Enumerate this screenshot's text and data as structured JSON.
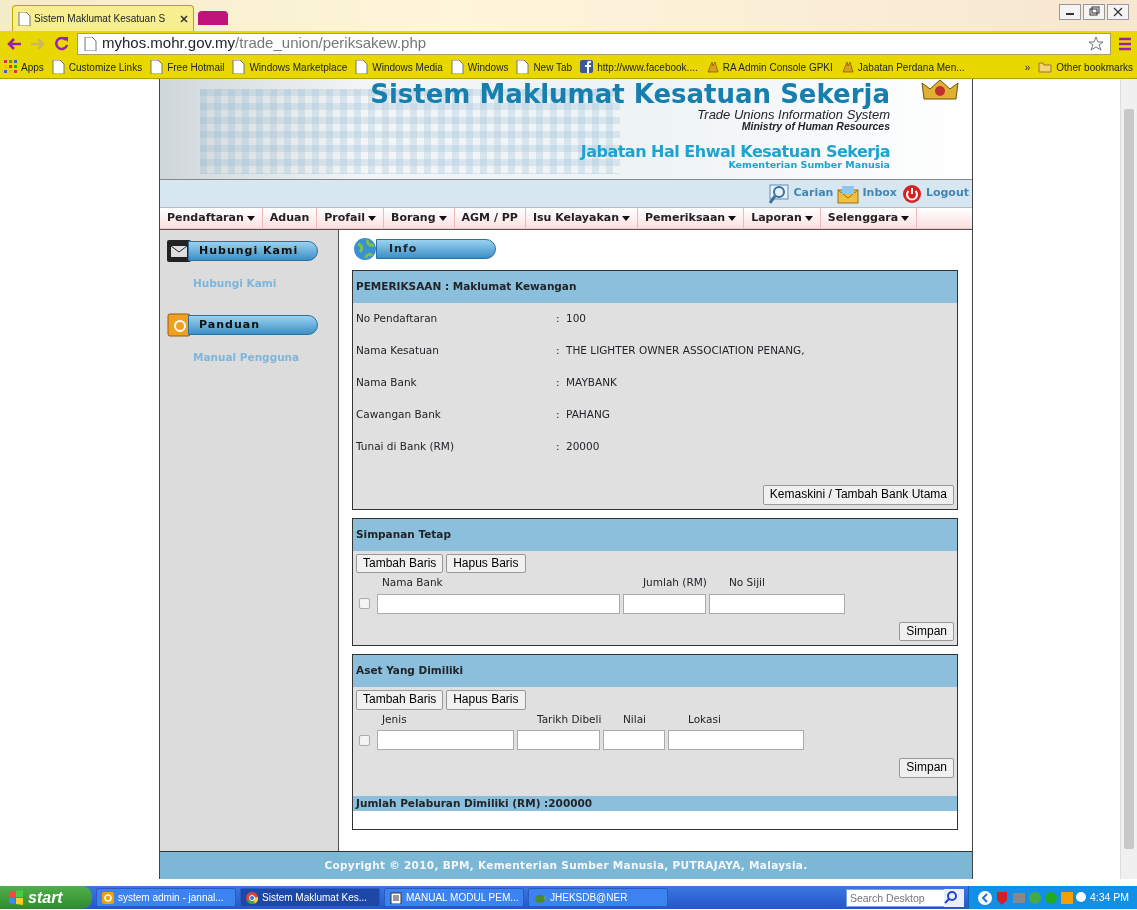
{
  "browser": {
    "tabs": [
      {
        "title": "Sistem Maklumat Kesatuan S",
        "selected": true
      }
    ],
    "address": {
      "host": "myhos.mohr.gov.my",
      "path": "/trade_union/periksakew.php"
    },
    "bookmarks": [
      {
        "label": "Apps",
        "kind": "apps"
      },
      {
        "label": "Customize Links",
        "kind": "page"
      },
      {
        "label": "Free Hotmail",
        "kind": "page"
      },
      {
        "label": "Windows Marketplace",
        "kind": "page"
      },
      {
        "label": "Windows Media",
        "kind": "page"
      },
      {
        "label": "Windows",
        "kind": "page"
      },
      {
        "label": "New Tab",
        "kind": "page"
      },
      {
        "label": "http://www.facebook....",
        "kind": "facebook"
      },
      {
        "label": "RA Admin Console GPKI",
        "kind": "emblem"
      },
      {
        "label": "Jabatan Perdana Men...",
        "kind": "emblem"
      }
    ],
    "bookmarks_more": "»",
    "other_bookmarks": "Other bookmarks"
  },
  "site": {
    "title": "Sistem Maklumat Kesatuan Sekerja",
    "subtitle": "Trade Unions Information System",
    "ministry": "Ministry of Human Resources",
    "department": "Jabatan Hal Ehwal Kesatuan Sekerja",
    "department_sub": "Kementerian Sumber Manusia",
    "toolbar": [
      {
        "label": "Carian",
        "kind": "search"
      },
      {
        "label": "Inbox",
        "kind": "mail"
      },
      {
        "label": "Logout",
        "kind": "power"
      }
    ],
    "menu": [
      {
        "label": "Pendaftaran",
        "dropdown": true
      },
      {
        "label": "Aduan",
        "dropdown": false
      },
      {
        "label": "Profail",
        "dropdown": true
      },
      {
        "label": "Borang",
        "dropdown": true
      },
      {
        "label": "AGM / PP",
        "dropdown": false
      },
      {
        "label": "Isu Kelayakan",
        "dropdown": true
      },
      {
        "label": "Pemeriksaan",
        "dropdown": true
      },
      {
        "label": "Laporan",
        "dropdown": true
      },
      {
        "label": "Selenggara",
        "dropdown": true
      }
    ],
    "sidebar": [
      {
        "heading": "Hubungi Kami",
        "kind": "mail",
        "links": [
          "Hubungi Kami"
        ]
      },
      {
        "heading": "Panduan",
        "kind": "book",
        "links": [
          "Manual Pengguna"
        ]
      }
    ],
    "info_heading": "Info",
    "finance": {
      "title": "PEMERIKSAAN : Maklumat Kewangan",
      "fields": [
        {
          "label": "No Pendaftaran",
          "sep": ":",
          "value": "100"
        },
        {
          "label": "Nama Kesatuan",
          "sep": ":",
          "value": "THE LIGHTER OWNER ASSOCIATION PENANG,"
        },
        {
          "label": "Nama Bank",
          "sep": ":",
          "value": "MAYBANK"
        },
        {
          "label": "Cawangan Bank",
          "sep": ":",
          "value": "PAHANG"
        },
        {
          "label": "Tunai di Bank (RM)",
          "sep": ":",
          "value": "20000"
        }
      ],
      "button": "Kemaskini / Tambah Bank Utama"
    },
    "grids": [
      {
        "title": "Simpanan Tetap",
        "buttons": [
          "Tambah Baris",
          "Hapus Baris"
        ],
        "columns": [
          "Nama Bank",
          "Jumlah (RM)",
          "No Sijil"
        ],
        "rows": [
          {
            "checked": false
          }
        ],
        "save": "Simpan"
      },
      {
        "title": "Aset Yang Dimiliki",
        "buttons": [
          "Tambah Baris",
          "Hapus Baris"
        ],
        "columns": [
          "Jenis",
          "Tarikh Dibeli",
          "Nilai",
          "Lokasi"
        ],
        "rows": [
          {
            "checked": false
          }
        ],
        "save": "Simpan"
      }
    ],
    "total": "Jumlah Pelaburan Dimiliki (RM) :200000",
    "footer": "Copyright © 2010, BPM, Kementerian Sumber Manusia, PUTRAJAYA, Malaysia."
  },
  "taskbar": {
    "start": "start",
    "tasks": [
      {
        "label": "system admin - jannal...",
        "kind": "outlook",
        "selected": false
      },
      {
        "label": "Sistem Maklumat Kes...",
        "kind": "chrome",
        "selected": true
      },
      {
        "label": "MANUAL MODUL PEM...",
        "kind": "doc",
        "selected": false
      },
      {
        "label": "JHEKSDB@NER",
        "kind": "turtle",
        "selected": false
      }
    ],
    "search_placeholder": "Search Desktop",
    "clock": "4:34 PM"
  }
}
